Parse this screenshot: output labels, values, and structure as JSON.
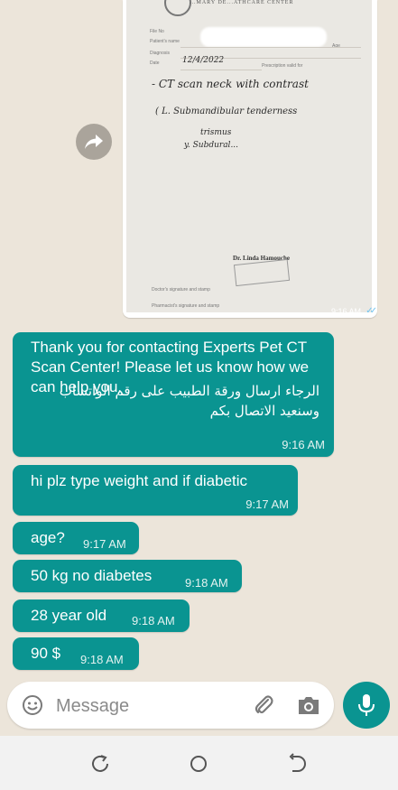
{
  "messages": [
    {
      "text_en": "Thank you for contacting Experts Pet CT Scan Center! Please let us know how we can help you.",
      "text_ar": "الرجاء ارسال ورقة الطبيب على رقم الواتساب وسنعيد الاتصال بكم",
      "time": "9:16 AM"
    },
    {
      "text": "hi plz type weight and if diabetic",
      "time": "9:17 AM"
    },
    {
      "text": "age?",
      "time": "9:17 AM"
    },
    {
      "text": "50 kg no diabetes",
      "time": "9:18 AM"
    },
    {
      "text": "28 year old",
      "time": "9:18 AM"
    },
    {
      "text": "90 $",
      "time": "9:18 AM"
    }
  ],
  "image_message": {
    "time": "9:16 AM",
    "prescription": {
      "header": "...MARY DE...ATHCARE CENTER",
      "date": "12/4/2022",
      "line1": "- CT scan neck with contrast",
      "line2": "( L. Submandibular tenderness",
      "line3": "trismus",
      "line4": "y. Subdural...",
      "doctor": "Dr. Linda Hamouche",
      "field_labels": {
        "file_no": "File No",
        "patient_name": "Patient's name",
        "age": "Age",
        "diagnosis": "Diagnosis",
        "date": "Date",
        "prescription_valid": "Prescription valid for",
        "doctor_sig": "Doctor's signature and stamp",
        "pharmacist_sig": "Pharmacist's signature and stamp"
      }
    }
  },
  "composer": {
    "placeholder": "Message"
  },
  "colors": {
    "accent": "#0a9491",
    "chat_bg": "#ece5da",
    "bubble_text": "#ffffff"
  },
  "icons": [
    "forward-icon",
    "emoji-icon",
    "attach-icon",
    "camera-icon",
    "mic-icon",
    "recents-icon",
    "home-icon",
    "back-icon"
  ]
}
